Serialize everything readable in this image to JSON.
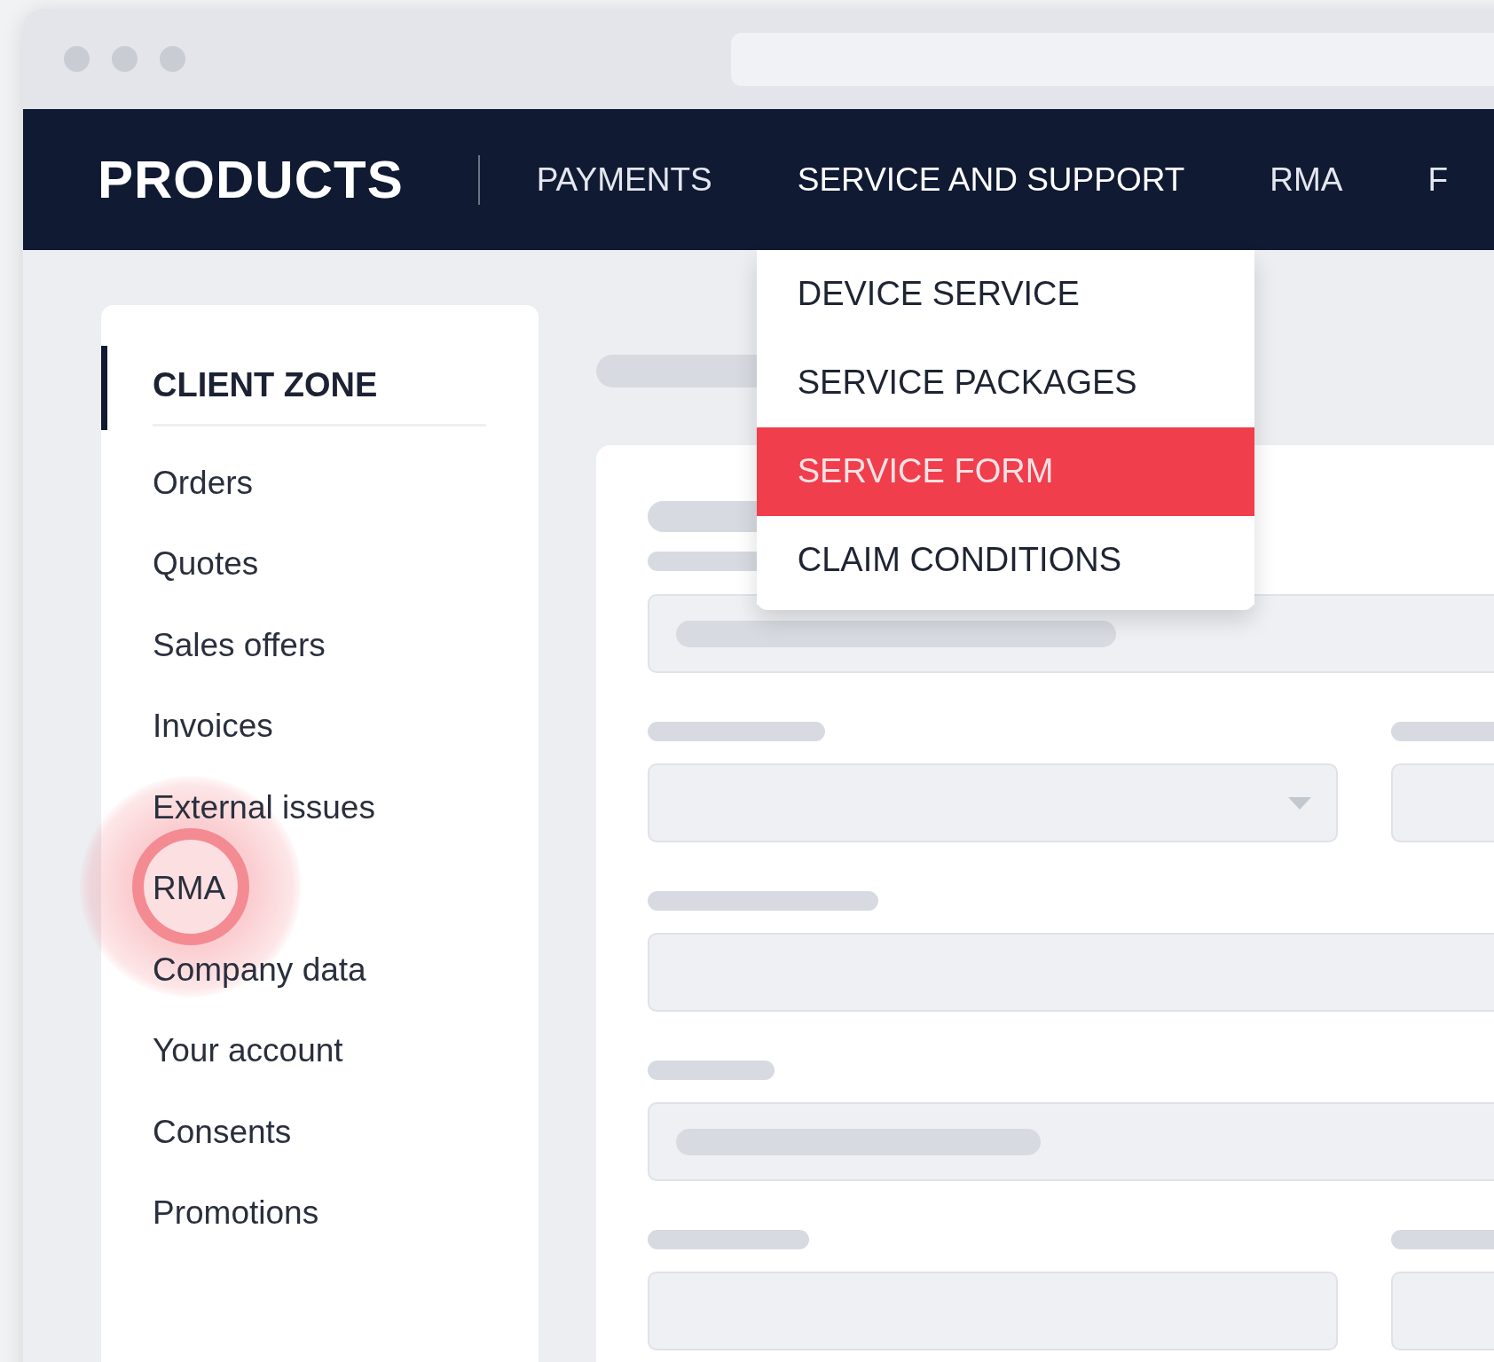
{
  "nav": {
    "brand": "PRODUCTS",
    "items": [
      {
        "label": "PAYMENTS",
        "open": false
      },
      {
        "label": "SERVICE AND SUPPORT",
        "open": true
      },
      {
        "label": "RMA",
        "open": false
      },
      {
        "label": "F",
        "open": false
      }
    ]
  },
  "dropdown": {
    "items": [
      {
        "label": "DEVICE SERVICE",
        "selected": false
      },
      {
        "label": "SERVICE PACKAGES",
        "selected": false
      },
      {
        "label": "SERVICE FORM",
        "selected": true
      },
      {
        "label": "CLAIM CONDITIONS",
        "selected": false
      }
    ]
  },
  "sidebar": {
    "title": "CLIENT ZONE",
    "items": [
      {
        "label": "Orders",
        "highlighted": false
      },
      {
        "label": "Quotes",
        "highlighted": false
      },
      {
        "label": "Sales offers",
        "highlighted": false
      },
      {
        "label": "Invoices",
        "highlighted": false
      },
      {
        "label": "External issues",
        "highlighted": false
      },
      {
        "label": "RMA",
        "highlighted": true
      },
      {
        "label": "Company data",
        "highlighted": false
      },
      {
        "label": "Your account",
        "highlighted": false
      },
      {
        "label": "Consents",
        "highlighted": false
      },
      {
        "label": "Promotions",
        "highlighted": false
      }
    ]
  }
}
